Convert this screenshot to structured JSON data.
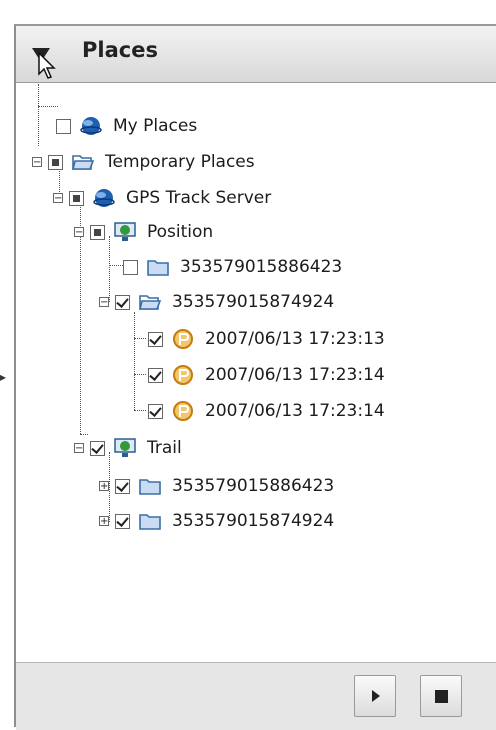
{
  "panel": {
    "title": "Places"
  },
  "tree": {
    "my_places": "My Places",
    "temporary_places": "Temporary Places",
    "gps_track_server": "GPS Track Server",
    "position": "Position",
    "position_devices": [
      {
        "label": "353579015886423",
        "checked": false
      },
      {
        "label": "353579015874924",
        "checked": true
      }
    ],
    "track_points": [
      {
        "label": "2007/06/13 17:23:13",
        "checked": true
      },
      {
        "label": "2007/06/13 17:23:14",
        "checked": true
      },
      {
        "label": "2007/06/13 17:23:14",
        "checked": true
      }
    ],
    "trail": "Trail",
    "trail_devices": [
      {
        "label": "353579015886423",
        "checked": true
      },
      {
        "label": "353579015874924",
        "checked": true
      }
    ]
  },
  "footer": {
    "play_icon": "play-icon",
    "stop_icon": "stop-icon"
  },
  "colors": {
    "globe": "#1e5fb0",
    "folder": "#3a6ea5",
    "point": "#e39a1c"
  }
}
